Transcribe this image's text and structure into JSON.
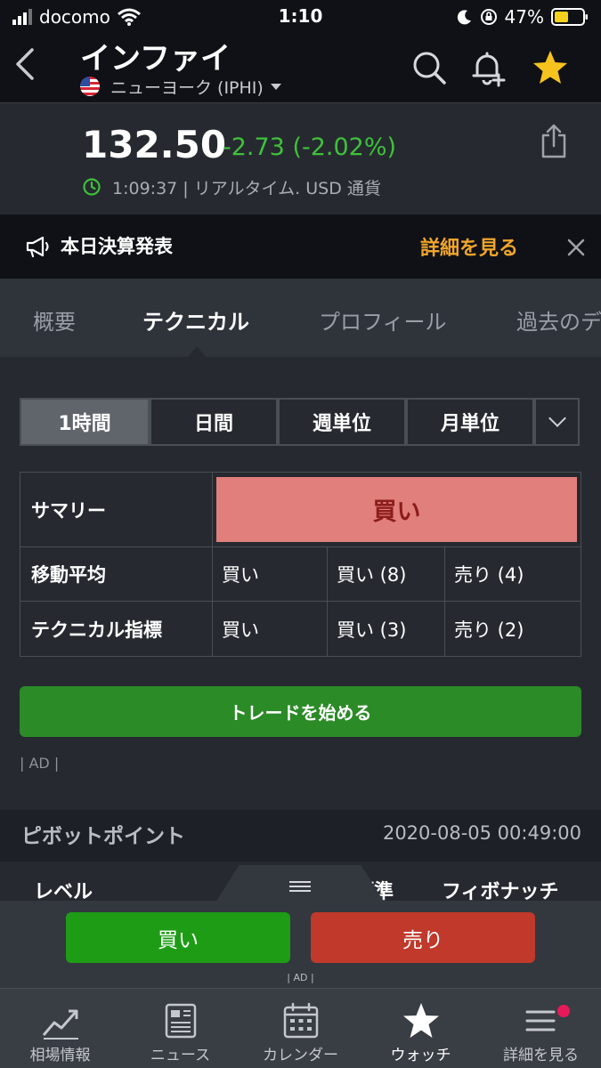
{
  "status_bar": {
    "carrier": "docomo",
    "time": "1:10",
    "battery": "47%"
  },
  "header": {
    "title": "インファイ",
    "exchange": "ニューヨーク (IPHI)"
  },
  "quote": {
    "price": "132.50",
    "change": "-2.73 (-2.02%)",
    "time_info": "1:09:37 | リアルタイム. USD 通貨"
  },
  "earnings": {
    "title": "本日決算発表",
    "link": "詳細を見る"
  },
  "tabs": [
    {
      "label": "概要"
    },
    {
      "label": "テクニカル"
    },
    {
      "label": "プロフィール"
    },
    {
      "label": "過去のデ"
    }
  ],
  "timeframes": [
    "1時間",
    "日間",
    "週単位",
    "月単位"
  ],
  "summary_table": {
    "summary_label": "サマリー",
    "summary_value": "買い",
    "rows": [
      {
        "label": "移動平均",
        "values": [
          "買い",
          "買い (8)",
          "売り (4)"
        ]
      },
      {
        "label": "テクニカル指標",
        "values": [
          "買い",
          "買い (3)",
          "売り (2)"
        ]
      }
    ]
  },
  "trade_button": "トレードを始める",
  "ad_label": "| AD |",
  "pivot": {
    "title": "ピボットポイント",
    "date": "2020-08-05 00:49:00",
    "columns": [
      "レベル",
      "標準",
      "フィボナッチ"
    ]
  },
  "actions": {
    "buy": "買い",
    "sell": "売り",
    "ad": "| AD |"
  },
  "bottom_nav": [
    {
      "label": "相場情報",
      "icon": "chart-icon"
    },
    {
      "label": "ニュース",
      "icon": "news-icon"
    },
    {
      "label": "カレンダー",
      "icon": "calendar-icon"
    },
    {
      "label": "ウォッチ",
      "icon": "star-icon"
    },
    {
      "label": "詳細を見る",
      "icon": "menu-icon"
    }
  ],
  "colors": {
    "accent_green": "#3fc13a",
    "accent_orange": "#f0a52b",
    "buy_green": "#1e9c16",
    "sell_red": "#c0392b",
    "summary_pink": "#e17f7c",
    "star_yellow": "#f6c21d"
  }
}
